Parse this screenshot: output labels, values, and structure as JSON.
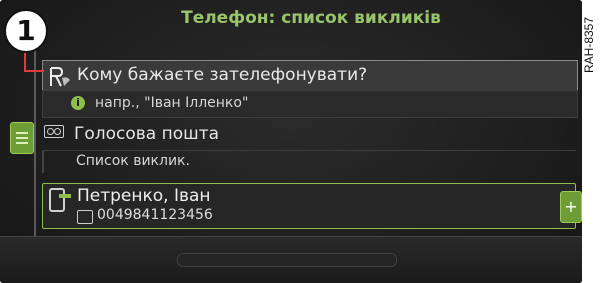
{
  "header": {
    "title": "Телефон: список викликів"
  },
  "callout": {
    "number": "1"
  },
  "side_label": "RAH-8357",
  "speech_prompt": {
    "label": "Кому бажаєте зателефонувати?",
    "hint": "напр., \"Іван Ілленко\"",
    "hint_icon": "i"
  },
  "voicemail": {
    "label": "Голосова пошта"
  },
  "call_list": {
    "label": "Список виклик."
  },
  "contact": {
    "name": "Петренко, Іван",
    "number": "0049841123456"
  },
  "add_button": {
    "symbol": "+"
  },
  "colors": {
    "accent_green": "#8dbf4a",
    "title_green": "#98c46a",
    "background": "#1b1b1b"
  }
}
